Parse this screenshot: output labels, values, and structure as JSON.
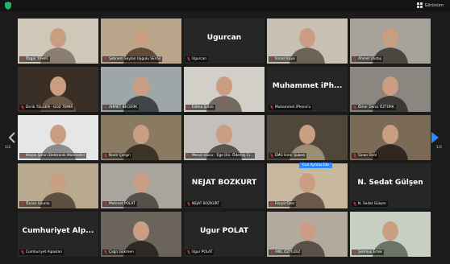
{
  "toolbar": {
    "view_label": "Görünüm"
  },
  "pagination": {
    "left_page": "1/2",
    "right_page": "1/2"
  },
  "speaking_tooltip": "Ece Aymaz İde",
  "colors": {
    "active_border": "#9ad13b",
    "mute_red": "#e0332f",
    "tooltip_blue": "#2d8cff",
    "arrow_blue": "#2d8cff"
  },
  "participants": [
    {
      "label": "Özgür TAHAT",
      "row": 0,
      "col": 0
    },
    {
      "label": "Şebnem Saylan Uygulu SEVGİ",
      "row": 0,
      "col": 1,
      "active": true
    },
    {
      "label": "Ugurcan",
      "row": 0,
      "col": 2,
      "display_name": "Ugurcan"
    },
    {
      "label": "İsmail Kaya",
      "row": 0,
      "col": 3
    },
    {
      "label": "Ahmet Ulutaş",
      "row": 0,
      "col": 4
    },
    {
      "label": "Derik YELGEN - GOZ TEMIR",
      "row": 1,
      "col": 0
    },
    {
      "label": "AHMET BECERİK",
      "row": 1,
      "col": 1
    },
    {
      "label": "Fatma Şahin",
      "row": 1,
      "col": 2
    },
    {
      "label": "Muhammet iPhone'u",
      "row": 1,
      "col": 3,
      "display_name": "Muhammet iPh..."
    },
    {
      "label": "Ömer Deniz ÖZTÜRK",
      "row": 1,
      "col": 4
    },
    {
      "label": "Hasan Şahin Elektronik Mühendisi",
      "row": 2,
      "col": 0
    },
    {
      "label": "Nadir Çergin",
      "row": 2,
      "col": 1
    },
    {
      "label": "Mesut Ulucu - Ege Üni. Ödemiş Ci...",
      "row": 2,
      "col": 2
    },
    {
      "label": "EMO İzmir Şubesi",
      "row": 2,
      "col": 3
    },
    {
      "label": "Sinan Ünal",
      "row": 2,
      "col": 4
    },
    {
      "label": "Özcan Uzunlu",
      "row": 3,
      "col": 0
    },
    {
      "label": "Mehmet POLAT",
      "row": 3,
      "col": 1
    },
    {
      "label": "NEJAT BOZKURT",
      "row": 3,
      "col": 2,
      "display_name": "NEJAT BOZKURT"
    },
    {
      "label": "Feryal Özer",
      "row": 3,
      "col": 3
    },
    {
      "label": "N. Sedat Gülşen",
      "row": 3,
      "col": 4,
      "display_name": "N. Sedat Gülşen"
    },
    {
      "label": "Cumhuriyet Alpaslan",
      "row": 4,
      "col": 0,
      "display_name": "Cumhuriyet Alp..."
    },
    {
      "label": "Çağrı Gökmen",
      "row": 4,
      "col": 1
    },
    {
      "label": "Ugur POLAT",
      "row": 4,
      "col": 2,
      "display_name": "Ugur POLAT"
    },
    {
      "label": "ANIL ÖZYILDIZ",
      "row": 4,
      "col": 3
    },
    {
      "label": "Şehmus Ertek",
      "row": 4,
      "col": 4
    }
  ]
}
